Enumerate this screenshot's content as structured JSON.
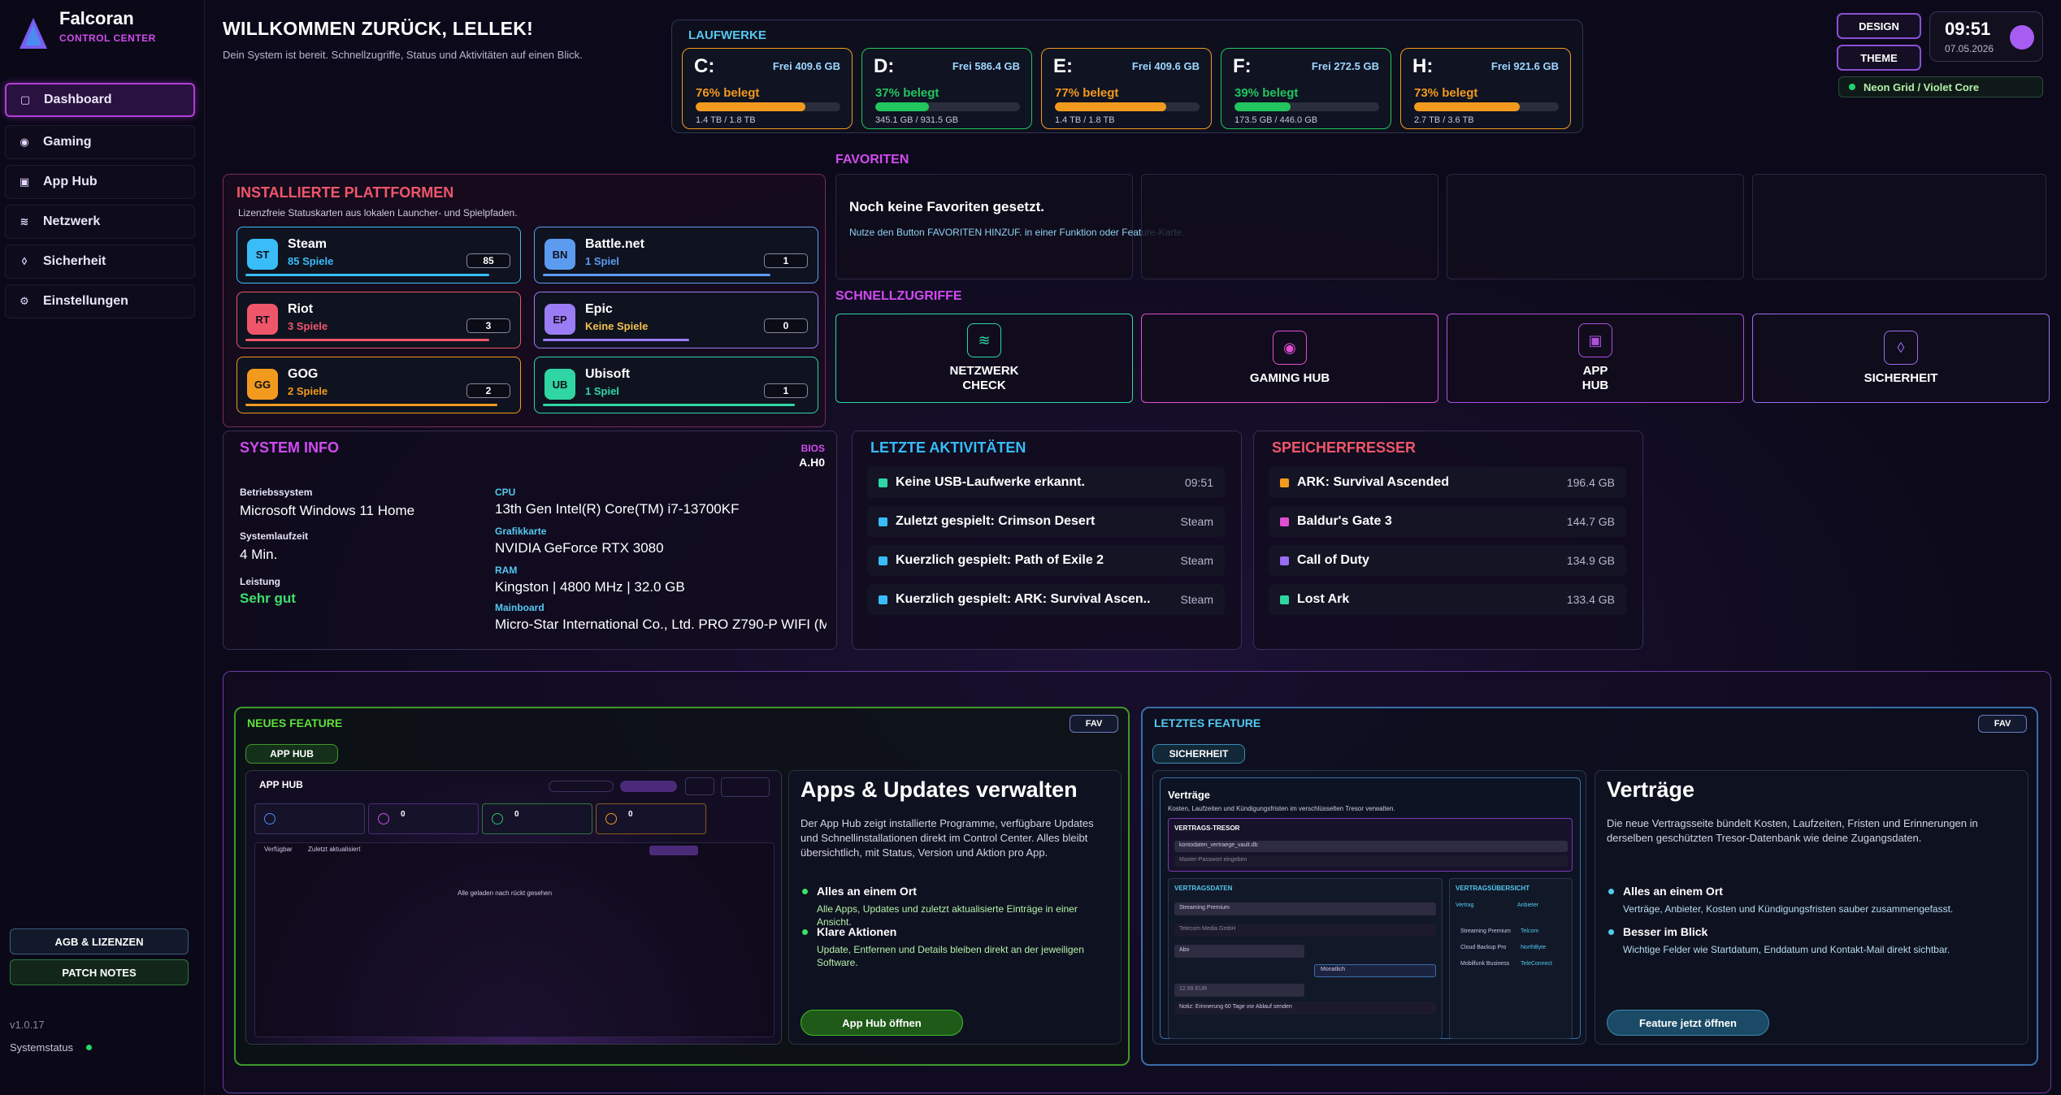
{
  "app": {
    "name": "Falcoran",
    "subtitle": "CONTROL CENTER",
    "version": "v1.0.17",
    "status_label": "Systemstatus"
  },
  "nav": [
    {
      "label": "Dashboard",
      "icon": "dashboard-icon"
    },
    {
      "label": "Gaming",
      "icon": "eye-icon"
    },
    {
      "label": "App Hub",
      "icon": "bag-icon"
    },
    {
      "label": "Netzwerk",
      "icon": "wifi-icon"
    },
    {
      "label": "Sicherheit",
      "icon": "shield-icon"
    },
    {
      "label": "Einstellungen",
      "icon": "gear-icon"
    }
  ],
  "sidebar_buttons": {
    "agb": "AGB & LIZENZEN",
    "patch": "PATCH NOTES"
  },
  "header": {
    "title": "WILLKOMMEN ZURÜCK, LELLEK!",
    "subtitle": "Dein System ist bereit. Schnellzugriffe, Status und Aktivitäten auf einen Blick."
  },
  "drives": {
    "title": "LAUFWERKE",
    "items": [
      {
        "letter": "C:",
        "free": "Frei 409.6 GB",
        "percent_label": "76% belegt",
        "used_fraction": 0.76,
        "size": "1.4 TB / 1.8 TB",
        "color": "#f29a1e"
      },
      {
        "letter": "D:",
        "free": "Frei 586.4 GB",
        "percent_label": "37% belegt",
        "used_fraction": 0.37,
        "size": "345.1 GB / 931.5 GB",
        "color": "#22c55e"
      },
      {
        "letter": "E:",
        "free": "Frei 409.6 GB",
        "percent_label": "77% belegt",
        "used_fraction": 0.77,
        "size": "1.4 TB / 1.8 TB",
        "color": "#f29a1e"
      },
      {
        "letter": "F:",
        "free": "Frei 272.5 GB",
        "percent_label": "39% belegt",
        "used_fraction": 0.39,
        "size": "173.5 GB / 446.0 GB",
        "color": "#22c55e"
      },
      {
        "letter": "H:",
        "free": "Frei 921.6 GB",
        "percent_label": "73% belegt",
        "used_fraction": 0.73,
        "size": "2.7 TB / 3.6 TB",
        "color": "#f29a1e"
      }
    ]
  },
  "top": {
    "design": "DESIGN",
    "theme": "THEME",
    "time": "09:51",
    "date": "07.05.2026",
    "theme_name": "Neon Grid / Violet Core"
  },
  "platforms": {
    "title": "INSTALLIERTE PLATTFORMEN",
    "subtitle": "Lizenzfreie Statuskarten aus lokalen Launcher- und Spielpfaden.",
    "items": [
      {
        "abbr": "ST",
        "name": "Steam",
        "count_label": "85 Spiele",
        "count": "85",
        "color": "#38bdf8"
      },
      {
        "abbr": "BN",
        "name": "Battle.net",
        "count_label": "1 Spiel",
        "count": "1",
        "color": "#5b9cf0"
      },
      {
        "abbr": "RT",
        "name": "Riot",
        "count_label": "3 Spiele",
        "count": "3",
        "color": "#f0566a"
      },
      {
        "abbr": "EP",
        "name": "Epic",
        "count_label": "Keine Spiele",
        "count": "0",
        "color": "#9a7cf5"
      },
      {
        "abbr": "GG",
        "name": "GOG",
        "count_label": "2 Spiele",
        "count": "2",
        "color": "#f29a1e"
      },
      {
        "abbr": "UB",
        "name": "Ubisoft",
        "count_label": "1 Spiel",
        "count": "1",
        "color": "#2fd6a4"
      }
    ]
  },
  "favorites": {
    "title": "FAVORITEN",
    "empty_title": "Noch keine Favoriten gesetzt.",
    "empty_text": "Nutze den Button FAVORITEN HINZUF. in einer Funktion oder Feature-Karte."
  },
  "quick": {
    "title": "SCHNELLZUGRIFFE",
    "items": [
      {
        "label": "NETZWERK\nCHECK",
        "icon": "wifi-icon",
        "color": "#2fd6a4"
      },
      {
        "label": "GAMING HUB",
        "icon": "eye-icon",
        "color": "#e04fd0"
      },
      {
        "label": "APP\nHUB",
        "icon": "bag-icon",
        "color": "#b04fe0"
      },
      {
        "label": "SICHERHEIT",
        "icon": "shield-icon",
        "color": "#9a6cf0"
      }
    ]
  },
  "sysinfo": {
    "title": "SYSTEM INFO",
    "bios_label": "BIOS",
    "bios": "A.H0",
    "os_label": "Betriebssystem",
    "os": "Microsoft Windows 11 Home",
    "uptime_label": "Systemlaufzeit",
    "uptime": "4 Min.",
    "perf_label": "Leistung",
    "perf": "Sehr gut",
    "cpu_label": "CPU",
    "cpu": "13th Gen Intel(R) Core(TM) i7-13700KF",
    "gpu_label": "Grafikkarte",
    "gpu": "NVIDIA GeForce RTX 3080",
    "ram_label": "RAM",
    "ram": "Kingston | 4800 MHz | 32.0 GB",
    "mb_label": "Mainboard",
    "mb": "Micro-Star International Co., Ltd. PRO Z790-P WIFI (M"
  },
  "activities": {
    "title": "LETZTE AKTIVITÄTEN",
    "items": [
      {
        "text": "Keine USB-Laufwerke erkannt.",
        "right": "09:51",
        "color": "#2fd6a4"
      },
      {
        "text": "Zuletzt gespielt: Crimson Desert",
        "right": "Steam",
        "color": "#38bdf8"
      },
      {
        "text": "Kuerzlich gespielt: Path of Exile 2",
        "right": "Steam",
        "color": "#38bdf8"
      },
      {
        "text": "Kuerzlich gespielt: ARK: Survival Ascen..",
        "right": "Steam",
        "color": "#38bdf8"
      }
    ]
  },
  "storage": {
    "title": "SPEICHERFRESSER",
    "items": [
      {
        "text": "ARK: Survival Ascended",
        "right": "196.4 GB",
        "color": "#f29a1e"
      },
      {
        "text": "Baldur's Gate 3",
        "right": "144.7 GB",
        "color": "#e04fd0"
      },
      {
        "text": "Call of Duty",
        "right": "134.9 GB",
        "color": "#9a6cf0"
      },
      {
        "text": "Lost Ark",
        "right": "133.4 GB",
        "color": "#2fd6a4"
      }
    ]
  },
  "feature_new": {
    "head": "NEUES FEATURE",
    "fav": "FAV",
    "tag": "APP HUB",
    "title": "Apps & Updates verwalten",
    "text": "Der App Hub zeigt installierte Programme, verfügbare Updates und Schnellinstallationen direkt im Control Center. Alles bleibt übersichtlich, mit Status, Version und Aktion pro App.",
    "b1": "Alles an einem Ort",
    "b1d": "Alle Apps, Updates und zuletzt aktualisierte Einträge in einer Ansicht.",
    "b2": "Klare Aktionen",
    "b2d": "Update, Entfernen und Details bleiben direkt an der jeweiligen Software.",
    "cta": "App Hub öffnen",
    "shot_title": "APP HUB",
    "shot_text": "Alle geladen nach rückt gesehen",
    "shot_nums": [
      "0",
      "0",
      "0"
    ],
    "shot_tabs": [
      "Verfügbar",
      "Zuletzt aktualisiert"
    ]
  },
  "feature_last": {
    "head": "LETZTES FEATURE",
    "fav": "FAV",
    "tag": "SICHERHEIT",
    "title": "Verträge",
    "text": "Die neue Vertragsseite bündelt Kosten, Laufzeiten, Fristen und Erinnerungen in derselben geschützten Tresor-Datenbank wie deine Zugangsdaten.",
    "b1": "Alles an einem Ort",
    "b1d": "Verträge, Anbieter, Kosten und Kündigungsfristen sauber zusammengefasst.",
    "b2": "Besser im Blick",
    "b2d": "Wichtige Felder wie Startdatum, Enddatum und Kontakt-Mail direkt sichtbar.",
    "cta": "Feature jetzt öffnen",
    "shot_title": "Verträge",
    "shot_sub": "Kosten, Laufzeiten und Kündigungsfristen im verschlüsselten Tresor verwalten.",
    "vault": "VERTRAGS-TRESOR",
    "vault_file": "kontodaten_vertraege_vault.db",
    "vault_pw": "Master-Passwort eingeben",
    "data_title": "VERTRAGSDATEN",
    "overview": "VERTRAGSÜBERSICHT",
    "col1": "Vertrag",
    "col2": "Anbieter",
    "fields": [
      "Streaming Premium",
      "Telecom Media GmbH",
      "Abo",
      "12,99 EUR",
      "Notiz: Erinnerung 60 Tage vor Ablauf senden"
    ],
    "monthly": "Monatlich",
    "rows": [
      [
        "Streaming Premium",
        "Telcom"
      ],
      [
        "Cloud Backup Pro",
        "NorthByte"
      ],
      [
        "Mobilfunk Business",
        "TeleConnect"
      ]
    ]
  }
}
